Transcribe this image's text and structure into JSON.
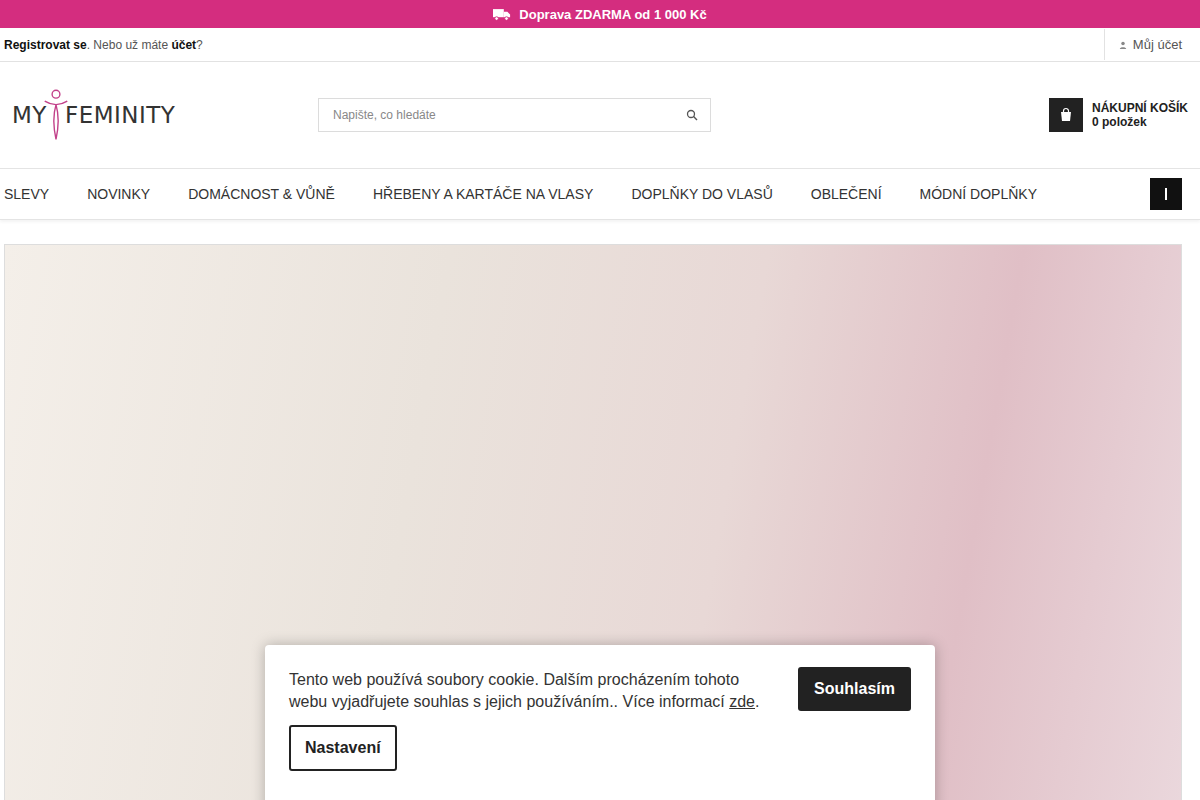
{
  "top_bar": {
    "text": "Doprava ZDARMA od 1 000 Kč"
  },
  "account_bar": {
    "register": "Registrovat se",
    "middle": ". Nebo už máte ",
    "account": "účet",
    "end": "?",
    "my_account": "Můj účet"
  },
  "logo": {
    "left": "MY",
    "right": "FEMINITY"
  },
  "search": {
    "placeholder": "Napište, co hledáte"
  },
  "cart": {
    "title": "NÁKUPNÍ KOŠÍK",
    "count": "0 položek"
  },
  "nav": [
    "SLEVY",
    "NOVINKY",
    "DOMÁCNOST & VŮNĚ",
    "HŘEBENY A KARTÁČE NA VLASY",
    "DOPLŇKY DO VLASŮ",
    "OBLEČENÍ",
    "MÓDNÍ DOPLŇKY"
  ],
  "cookie": {
    "text": "Tento web používá soubory cookie. Dalším procházením tohoto webu vyjadřujete souhlas s jejich používáním.. Více informací ",
    "link": "zde",
    "end": ".",
    "accept": "Souhlasím",
    "settings": "Nastavení"
  }
}
